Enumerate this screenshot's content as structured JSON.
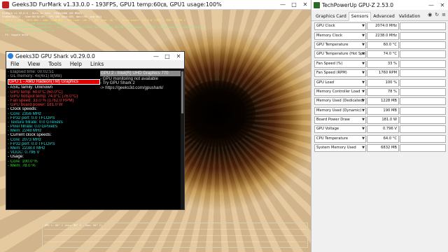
{
  "furmark": {
    "title": "Geeks3D FurMark v1.33.0.0 - 193FPS, GPU1 temp:60㎝, GPU1 usage:100%",
    "hud_lines": [
      {
        "text": "FurMark v1.33.0.0 - Burn-in test, 1920x1080 (8X MSAA)",
        "tone": "w"
      },
      {
        "text": "Frames:81715 - time:00:02:09 - FPS:193 (min:165, max:194, avg:192)",
        "tone": "w"
      },
      {
        "text": "[ GPU-Z ] core: 2074 MHz - mem: 2238 MHz - GPU load: 100 % - GPU temp: 60 °C - board power: 181.0 W (TPD) - VDDC: 0.796 V",
        "tone": "y"
      },
      {
        "text": "> OpenGL renderer: AMD Radeon(TM) Graphics",
        "tone": "g"
      },
      {
        "text": "> GPU 1 (AMD Radeon(TM) Graphics) - core: 2074MHz:60°C:100%, mem: 2238MHz:181.0W, board power: 181.0W, limits:power:1, temp:0, volt:0",
        "tone": "g"
      },
      {
        "text": "> GPU 2 (Intel(R) UHD Graphics 770)",
        "tone": "g"
      },
      {
        "text": "- F1: toggle help",
        "tone": "w"
      }
    ],
    "graph_label": "GPU 1: 60° C (min: 55° C - max: 60° C)"
  },
  "gpushark": {
    "title": "Geeks3D GPU Shark v0.29.0.0",
    "menu": [
      "File",
      "View",
      "Tools",
      "Help",
      "Links"
    ],
    "left": [
      {
        "text": "- Elapsed time: 00:02:51",
        "tone": "gray"
      },
      {
        "text": "- GL memory: 4x(4x1) 8(MB)",
        "tone": "gray"
      },
      {
        "text": "GPU 1 - AMD Radeon(TM) Graphics",
        "tone": "sel"
      },
      {
        "text": "- ASIC family: Unknown",
        "tone": "sec"
      },
      {
        "text": "- GPU temp: 60.0°C (60.0°C)",
        "tone": "red"
      },
      {
        "text": "- GPU hotspot temp: 74.0°C (76.0°C)",
        "tone": "red"
      },
      {
        "text": "- Fan speed: 33.0 % (1762.0 RPM)",
        "tone": "red"
      },
      {
        "text": "- GPU board power: 181.0 W",
        "tone": "red"
      },
      {
        "text": "- Clock speeds:",
        "tone": "sec"
      },
      {
        "text": "  - Core: 2356 MHz",
        "tone": "cyan"
      },
      {
        "text": "  - FP32 perf: 0.0 TFLOPS",
        "tone": "cyan"
      },
      {
        "text": "  - Texture fillrate: 0.0 GTexel/s",
        "tone": "cyan"
      },
      {
        "text": "  - Pixel fillrate: 0.0 GPixel/s",
        "tone": "cyan"
      },
      {
        "text": "  - Mem: 2248 MHz",
        "tone": "cyan"
      },
      {
        "text": "- Current clock speeds:",
        "tone": "sec"
      },
      {
        "text": "  - Core: 2073 MHz",
        "tone": "cyan"
      },
      {
        "text": "  - FP32 perf: 0.0 TFLOPS",
        "tone": "cyan"
      },
      {
        "text": "  - Mem: 2238.0 MHz",
        "tone": "cyan"
      },
      {
        "text": "  - VDDC: 0.796 V",
        "tone": "cyan"
      },
      {
        "text": "- Usage:",
        "tone": "sec"
      },
      {
        "text": "  - Core: 100.0 %",
        "tone": "green"
      },
      {
        "text": "  - Mem: 78.0 %",
        "tone": "green"
      }
    ],
    "right_header": "GPU 2 - Intel(R) UHD Graphics 770",
    "right": [
      "- GPU monitoring not available",
      "- Try GPU Shark 2",
      "-> https://geeks3d.com/gpushark/"
    ]
  },
  "gpuz": {
    "title": "TechPowerUp GPU-Z 2.53.0",
    "tabs": [
      "Graphics Card",
      "Sensors",
      "Advanced",
      "Validation"
    ],
    "active_tab": "Sensors",
    "sensors": [
      {
        "name": "GPU Clock",
        "value": "2074.0 MHz",
        "level": 0.85
      },
      {
        "name": "Memory Clock",
        "value": "2238.0 MHz",
        "level": 0.9
      },
      {
        "name": "GPU Temperature",
        "value": "60.0 °C",
        "level": 0.6
      },
      {
        "name": "GPU Temperature (Hot Spot)",
        "value": "74.0 °C",
        "level": 0.72
      },
      {
        "name": "Fan Speed (%)",
        "value": "33 %",
        "level": 0.33
      },
      {
        "name": "Fan Speed (RPM)",
        "value": "1760 RPM",
        "level": 0.4
      },
      {
        "name": "GPU Load",
        "value": "100 %",
        "level": 1.0
      },
      {
        "name": "Memory Controller Load",
        "value": "78 %",
        "level": 0.78
      },
      {
        "name": "Memory Used (Dedicated)",
        "value": "1228 MB",
        "level": 0.3
      },
      {
        "name": "Memory Used (Dynamic)",
        "value": "190 MB",
        "level": 0.05
      },
      {
        "name": "Board Power Draw",
        "value": "181.0 W",
        "level": 0.8
      },
      {
        "name": "GPU Voltage",
        "value": "0.796 V",
        "level": 0.55
      },
      {
        "name": "CPU Temperature",
        "value": "64.0 °C",
        "level": 0.64
      },
      {
        "name": "System Memory Used",
        "value": "6832 MB",
        "level": 0.45
      }
    ]
  }
}
